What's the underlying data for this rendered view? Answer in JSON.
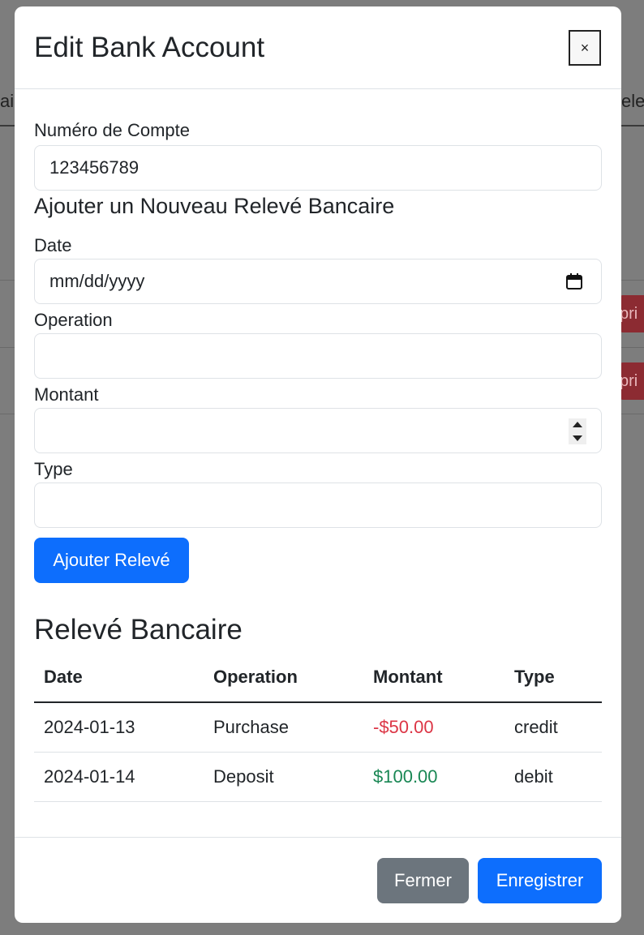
{
  "background": {
    "tab_left_fragment": "ai",
    "tab_right_fragment": "ele",
    "row_button_fragment": "pri"
  },
  "modal": {
    "title": "Edit Bank Account",
    "close_label": "×"
  },
  "form": {
    "account_label": "Numéro de Compte",
    "account_value": "123456789",
    "new_statement_heading": "Ajouter un Nouveau Relevé Bancaire",
    "date_label": "Date",
    "date_placeholder": "mm/dd/yyyy",
    "operation_label": "Operation",
    "operation_value": "",
    "amount_label": "Montant",
    "amount_value": "",
    "type_label": "Type",
    "type_value": "",
    "add_button": "Ajouter Relevé"
  },
  "statement": {
    "heading": "Relevé Bancaire",
    "columns": [
      "Date",
      "Operation",
      "Montant",
      "Type"
    ],
    "rows": [
      {
        "date": "2024-01-13",
        "operation": "Purchase",
        "amount": "-$50.00",
        "type": "credit"
      },
      {
        "date": "2024-01-14",
        "operation": "Deposit",
        "amount": "$100.00",
        "type": "debit"
      }
    ]
  },
  "footer": {
    "close_button": "Fermer",
    "save_button": "Enregistrer"
  },
  "colors": {
    "primary": "#0d6efd",
    "secondary": "#6c757d",
    "negative": "#dc3545",
    "positive": "#198754"
  }
}
